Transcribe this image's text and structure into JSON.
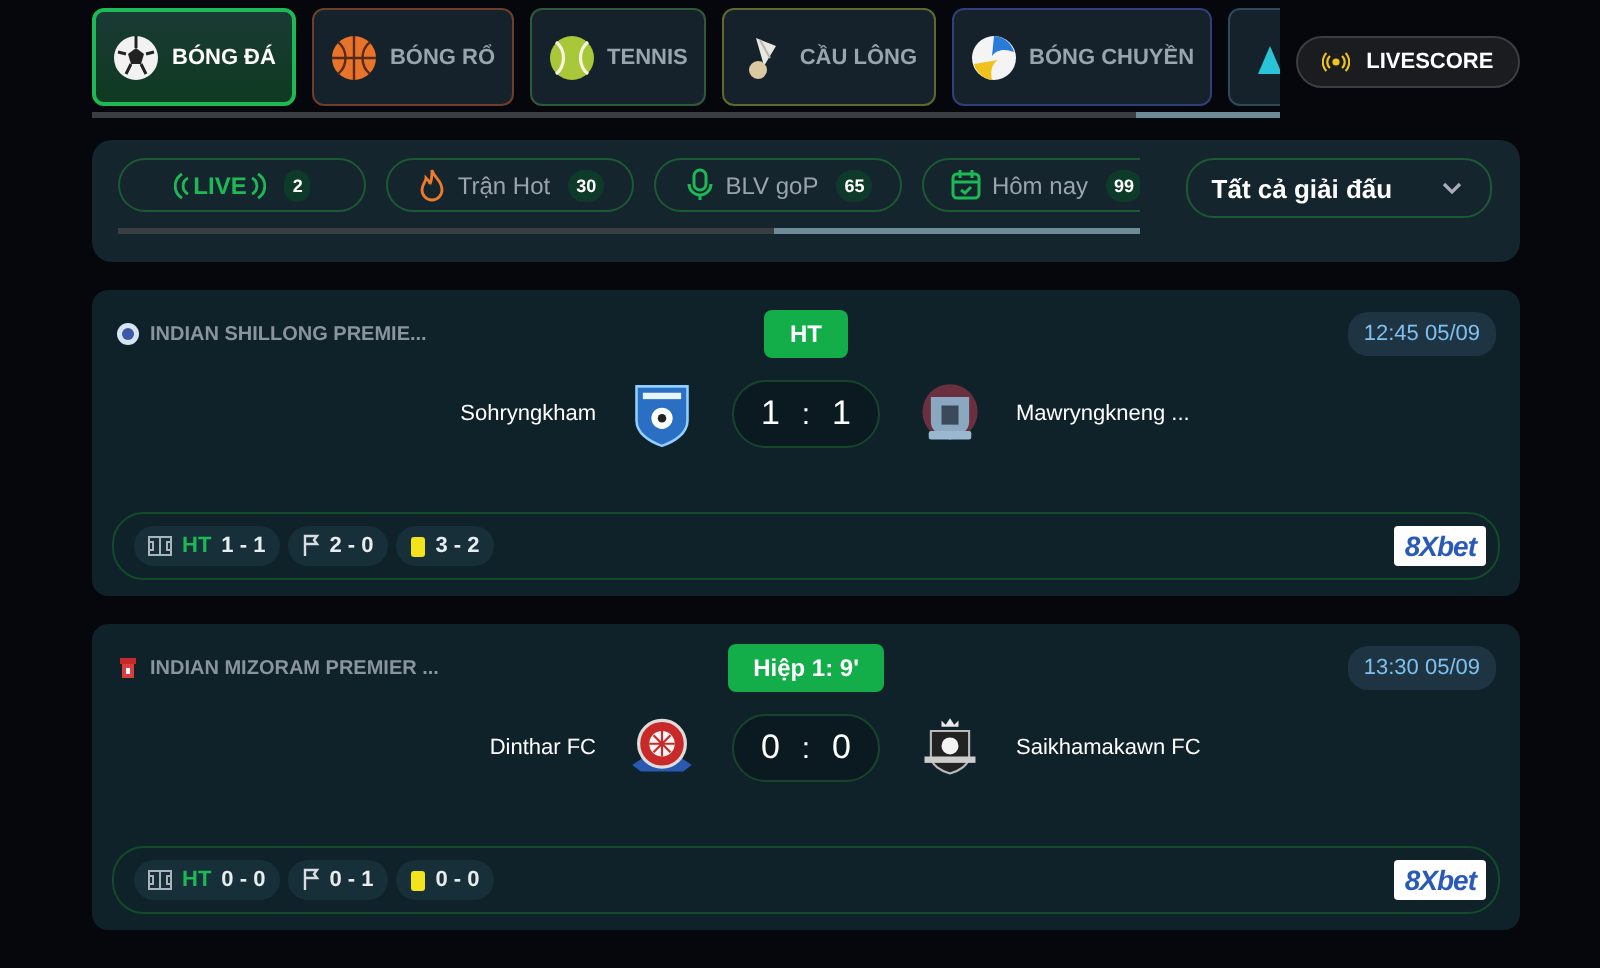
{
  "sport_tabs": [
    {
      "label": "BÓNG ĐÁ",
      "kind": "soccer",
      "color": "#1db954",
      "selected": true
    },
    {
      "label": "BÓNG RỔ",
      "kind": "basketball",
      "color": "#6b3f2a",
      "selected": false
    },
    {
      "label": "TENNIS",
      "kind": "tennis",
      "color": "#2e5a3a",
      "selected": false
    },
    {
      "label": "CẦU LÔNG",
      "kind": "badminton",
      "color": "#5f6a2a",
      "selected": false
    },
    {
      "label": "BÓNG CHUYỀN",
      "kind": "volleyball",
      "color": "#2e3f7a",
      "selected": false
    },
    {
      "kind": "other",
      "color": "#2e4a5a",
      "selected": false
    }
  ],
  "livescore_button": {
    "label": "LIVESCORE"
  },
  "filters": [
    {
      "label": "LIVE",
      "kind": "live",
      "count": "2",
      "selected": true
    },
    {
      "label": "Trận Hot",
      "kind": "hot",
      "count": "30",
      "selected": false
    },
    {
      "label": "BLV goP",
      "kind": "mic",
      "count": "65",
      "selected": false
    },
    {
      "label": "Hôm nay",
      "kind": "calendar",
      "count": "99",
      "selected": false
    }
  ],
  "league_select": {
    "value": "Tất cả giải đấu"
  },
  "matches": [
    {
      "league": {
        "name": "INDIAN SHILLONG PREMIE...",
        "kind": "disc"
      },
      "status": "HT",
      "time": "12:45 05/09",
      "home": {
        "name": "Sohryngkham",
        "kind": "shield"
      },
      "away": {
        "name": "Mawryngkneng ...",
        "kind": "round"
      },
      "score_home": "1",
      "score_separator": ":",
      "score_away": "1",
      "stats": [
        {
          "kind": "half",
          "label": "HT",
          "value": "1 - 1"
        },
        {
          "kind": "corner",
          "value": "2 - 0"
        },
        {
          "kind": "card",
          "value": "3 - 2"
        }
      ],
      "bookmaker": "8Xbet"
    },
    {
      "league": {
        "name": "INDIAN MIZORAM PREMIER ...",
        "kind": "tower"
      },
      "status": "Hiệp 1: 9'",
      "time": "13:30 05/09",
      "home": {
        "name": "Dinthar FC",
        "kind": "wheel"
      },
      "away": {
        "name": "Saikhamakawn FC",
        "kind": "crowned"
      },
      "score_home": "0",
      "score_separator": ":",
      "score_away": "0",
      "stats": [
        {
          "kind": "half",
          "label": "HT",
          "value": "0 - 0"
        },
        {
          "kind": "corner",
          "value": "0 - 1"
        },
        {
          "kind": "card",
          "value": "0 - 0"
        }
      ],
      "bookmaker": "8Xbet"
    }
  ]
}
